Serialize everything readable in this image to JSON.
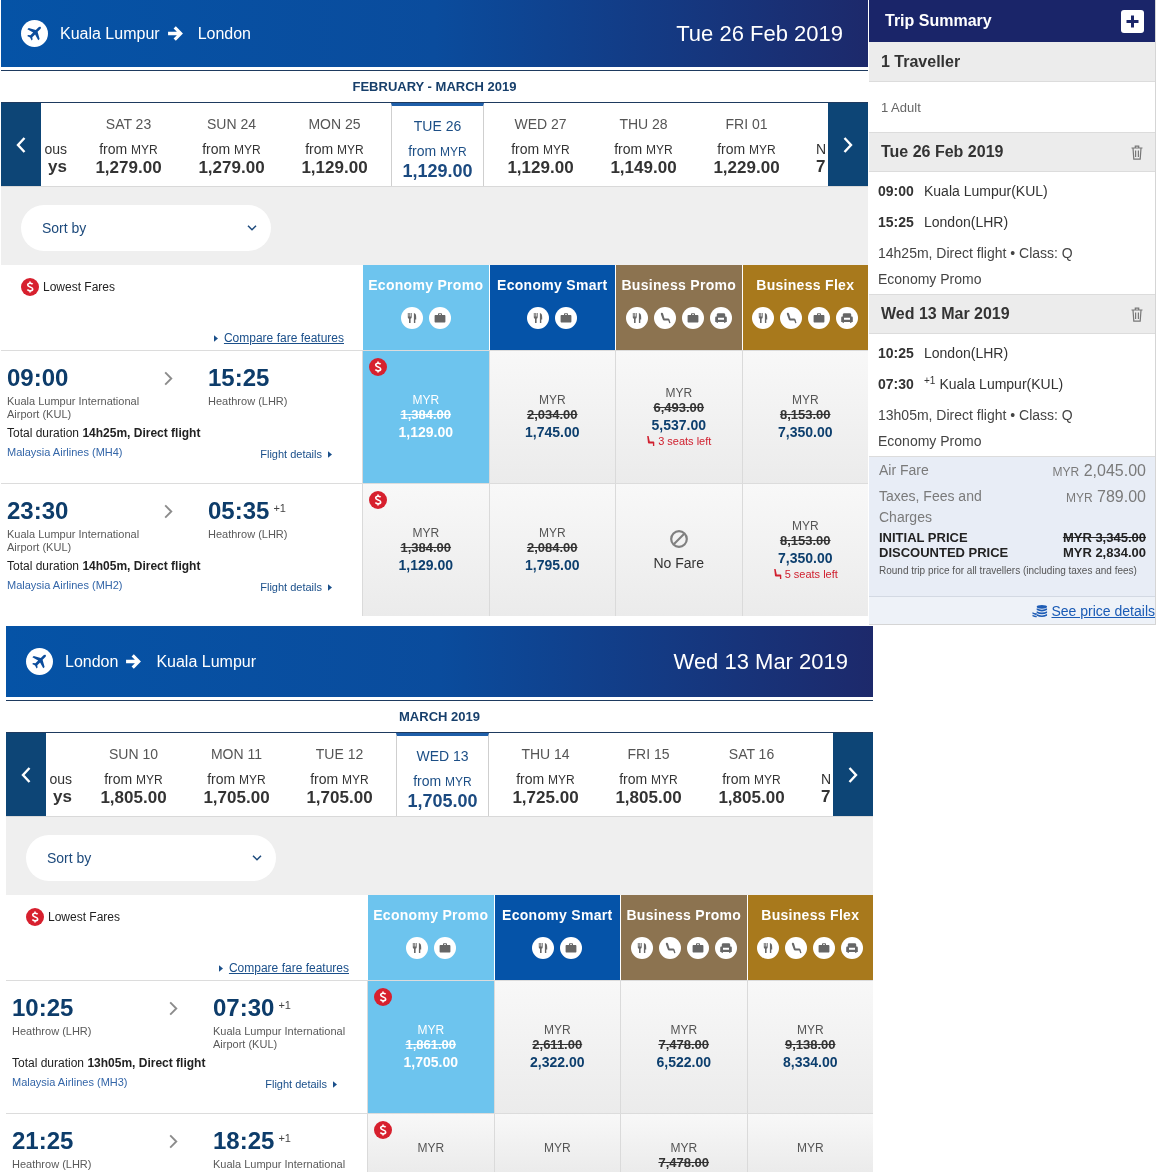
{
  "trips": [
    {
      "route": {
        "origin": "Kuala Lumpur",
        "destination": "London"
      },
      "date": "Tue 26 Feb 2019",
      "month_label": "FEBRUARY - MARCH 2019",
      "date_strip": {
        "previous_partial": {
          "line_1": "ous",
          "line_2": "ys"
        },
        "days": [
          {
            "day": "SAT 23",
            "from": "from",
            "currency": "MYR",
            "price": "1,279.00",
            "selected": false
          },
          {
            "day": "SUN 24",
            "from": "from",
            "currency": "MYR",
            "price": "1,279.00",
            "selected": false
          },
          {
            "day": "MON 25",
            "from": "from",
            "currency": "MYR",
            "price": "1,129.00",
            "selected": false
          },
          {
            "day": "TUE 26",
            "from": "from",
            "currency": "MYR",
            "price": "1,129.00",
            "selected": true
          },
          {
            "day": "WED 27",
            "from": "from",
            "currency": "MYR",
            "price": "1,129.00",
            "selected": false
          },
          {
            "day": "THU 28",
            "from": "from",
            "currency": "MYR",
            "price": "1,149.00",
            "selected": false
          },
          {
            "day": "FRI 01",
            "from": "from",
            "currency": "MYR",
            "price": "1,229.00",
            "selected": false
          }
        ],
        "next_partial": {
          "line_1": "N",
          "line_2": "7"
        }
      },
      "sort": {
        "label": "Sort by"
      },
      "legend": {
        "label": "Lowest Fares"
      },
      "compare_link": "Compare fare features",
      "fare_families": [
        {
          "name": "Economy Promo",
          "kind": "economy",
          "color": "#6dc4ee"
        },
        {
          "name": "Economy Smart",
          "kind": "economy",
          "color": "#0553a8"
        },
        {
          "name": "Business Promo",
          "kind": "business",
          "color": "#8c7350"
        },
        {
          "name": "Business Flex",
          "kind": "business",
          "color": "#a8791c"
        }
      ],
      "flights": [
        {
          "depart": {
            "time": "09:00",
            "airport": "Kuala Lumpur International Airport (KUL)"
          },
          "arrive": {
            "time": "15:25",
            "airport": "Heathrow (LHR)"
          },
          "duration": "Total duration **14h25m, Direct flight**",
          "airline": "Malaysia Airlines (MH4)",
          "details_link": "Flight details",
          "fares": [
            {
              "kind": "price",
              "currency": "MYR",
              "old_price": "1,384.00",
              "price": "1,129.00",
              "selected": true,
              "lowest": true
            },
            {
              "kind": "price",
              "currency": "MYR",
              "old_price": "2,034.00",
              "price": "1,745.00",
              "selected": false,
              "lowest": false
            },
            {
              "kind": "price",
              "currency": "MYR",
              "old_price": "6,493.00",
              "price": "5,537.00",
              "seats_left": "3 seats left",
              "selected": false,
              "lowest": false
            },
            {
              "kind": "price",
              "currency": "MYR",
              "old_price": "8,153.00",
              "price": "7,350.00",
              "selected": false,
              "lowest": false
            }
          ]
        },
        {
          "depart": {
            "time": "23:30",
            "airport": "Kuala Lumpur International Airport (KUL)"
          },
          "arrive": {
            "time": "05:35",
            "day_offset": "+1",
            "airport": "Heathrow (LHR)"
          },
          "duration": "Total duration **14h05m, Direct flight**",
          "airline": "Malaysia Airlines (MH2)",
          "details_link": "Flight details",
          "fares": [
            {
              "kind": "price",
              "currency": "MYR",
              "old_price": "1,384.00",
              "price": "1,129.00",
              "selected": false,
              "lowest": true
            },
            {
              "kind": "price",
              "currency": "MYR",
              "old_price": "2,084.00",
              "price": "1,795.00",
              "selected": false,
              "lowest": false
            },
            {
              "kind": "none",
              "label": "No Fare",
              "selected": false,
              "lowest": false
            },
            {
              "kind": "price",
              "currency": "MYR",
              "old_price": "8,153.00",
              "price": "7,350.00",
              "seats_left": "5 seats left",
              "selected": false,
              "lowest": false
            }
          ]
        }
      ]
    },
    {
      "route": {
        "origin": "London",
        "destination": "Kuala Lumpur"
      },
      "date": "Wed 13 Mar 2019",
      "month_label": "MARCH 2019",
      "date_strip": {
        "previous_partial": {
          "line_1": "ous",
          "line_2": "ys"
        },
        "days": [
          {
            "day": "SUN 10",
            "from": "from",
            "currency": "MYR",
            "price": "1,805.00",
            "selected": false
          },
          {
            "day": "MON 11",
            "from": "from",
            "currency": "MYR",
            "price": "1,705.00",
            "selected": false
          },
          {
            "day": "TUE 12",
            "from": "from",
            "currency": "MYR",
            "price": "1,705.00",
            "selected": false
          },
          {
            "day": "WED 13",
            "from": "from",
            "currency": "MYR",
            "price": "1,705.00",
            "selected": true
          },
          {
            "day": "THU 14",
            "from": "from",
            "currency": "MYR",
            "price": "1,725.00",
            "selected": false
          },
          {
            "day": "FRI 15",
            "from": "from",
            "currency": "MYR",
            "price": "1,805.00",
            "selected": false
          },
          {
            "day": "SAT 16",
            "from": "from",
            "currency": "MYR",
            "price": "1,805.00",
            "selected": false
          }
        ],
        "next_partial": {
          "line_1": "N",
          "line_2": "7"
        }
      },
      "sort": {
        "label": "Sort by"
      },
      "legend": {
        "label": "Lowest Fares"
      },
      "compare_link": "Compare fare features",
      "fare_families": [
        {
          "name": "Economy Promo",
          "kind": "economy",
          "color": "#6dc4ee"
        },
        {
          "name": "Economy Smart",
          "kind": "economy",
          "color": "#0553a8"
        },
        {
          "name": "Business Promo",
          "kind": "business",
          "color": "#8c7350"
        },
        {
          "name": "Business Flex",
          "kind": "business",
          "color": "#a8791c"
        }
      ],
      "flights": [
        {
          "depart": {
            "time": "10:25",
            "airport": "Heathrow (LHR)"
          },
          "arrive": {
            "time": "07:30",
            "day_offset": "+1",
            "airport": "Kuala Lumpur International Airport (KUL)"
          },
          "duration": "Total duration **13h05m, Direct flight**",
          "airline": "Malaysia Airlines (MH3)",
          "details_link": "Flight details",
          "fares": [
            {
              "kind": "price",
              "currency": "MYR",
              "old_price": "1,861.00",
              "price": "1,705.00",
              "selected": true,
              "lowest": true
            },
            {
              "kind": "price",
              "currency": "MYR",
              "old_price": "2,611.00",
              "price": "2,322.00",
              "selected": false,
              "lowest": false
            },
            {
              "kind": "price",
              "currency": "MYR",
              "old_price": "7,478.00",
              "price": "6,522.00",
              "selected": false,
              "lowest": false
            },
            {
              "kind": "price",
              "currency": "MYR",
              "old_price": "9,138.00",
              "price": "8,334.00",
              "selected": false,
              "lowest": false
            }
          ]
        },
        {
          "depart": {
            "time": "21:25",
            "airport": "Heathrow (LHR)"
          },
          "arrive": {
            "time": "18:25",
            "day_offset": "+1",
            "airport": "Kuala Lumpur International"
          },
          "fares": [
            {
              "kind": "price",
              "currency": "MYR",
              "selected": false,
              "lowest": true
            },
            {
              "kind": "price",
              "currency": "MYR",
              "selected": false,
              "lowest": false
            },
            {
              "kind": "price",
              "currency": "MYR",
              "old_price": "7,478.00",
              "selected": false,
              "lowest": false
            },
            {
              "kind": "price",
              "currency": "MYR",
              "selected": false,
              "lowest": false
            }
          ]
        }
      ]
    }
  ],
  "trip_summary": {
    "title": "Trip Summary",
    "travellers": {
      "heading": "1 Traveller",
      "items": [
        "1 Adult"
      ]
    },
    "legs": [
      {
        "date": "Tue 26 Feb 2019",
        "stops": [
          {
            "time": "09:00",
            "place": "Kuala Lumpur(KUL)"
          },
          {
            "time": "15:25",
            "place": "London(LHR)"
          }
        ],
        "info": "14h25m, Direct flight • Class: Q",
        "fare": "Economy Promo"
      },
      {
        "date": "Wed 13 Mar 2019",
        "stops": [
          {
            "time": "10:25",
            "place": "London(LHR)"
          },
          {
            "time": "07:30",
            "day_offset": "+1",
            "place": "Kuala Lumpur(KUL)"
          }
        ],
        "info": "13h05m, Direct flight • Class: Q",
        "fare": "Economy Promo"
      }
    ],
    "charges": [
      {
        "label": "Air Fare",
        "currency": "MYR",
        "amount": "2,045.00"
      },
      {
        "label": "Taxes, Fees and Charges",
        "currency": "MYR",
        "amount": "789.00"
      }
    ],
    "totals": [
      {
        "label": "INITIAL PRICE",
        "amount": "MYR 3,345.00",
        "struck": true
      },
      {
        "label": "DISCOUNTED PRICE",
        "amount": "MYR 2,834.00",
        "struck": false
      }
    ],
    "note": "Round trip price for all travellers (including taxes and fees)",
    "details_link": "See price details"
  }
}
